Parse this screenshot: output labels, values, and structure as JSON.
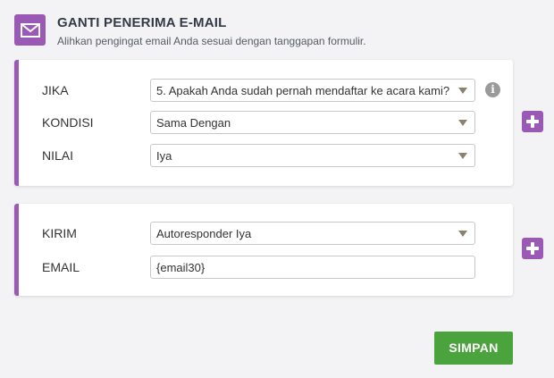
{
  "header": {
    "icon": "envelope-icon",
    "title": "GANTI PENERIMA E-MAIL",
    "subtitle": "Alihkan pengingat email Anda sesuai dengan tanggapan formulir."
  },
  "condition_card": {
    "rows": [
      {
        "label": "JIKA",
        "value": "5. Apakah Anda sudah pernah mendaftar ke acara kami?"
      },
      {
        "label": "KONDISI",
        "value": "Sama Dengan"
      },
      {
        "label": "NILAI",
        "value": "Iya"
      }
    ],
    "info_icon": "i"
  },
  "action_card": {
    "rows": [
      {
        "label": "KIRIM",
        "value": "Autoresponder Iya"
      },
      {
        "label": "EMAIL",
        "value": "{email30}"
      }
    ]
  },
  "buttons": {
    "save_label": "SIMPAN"
  },
  "colors": {
    "accent": "#9b59b6",
    "save": "#4aa33c"
  }
}
